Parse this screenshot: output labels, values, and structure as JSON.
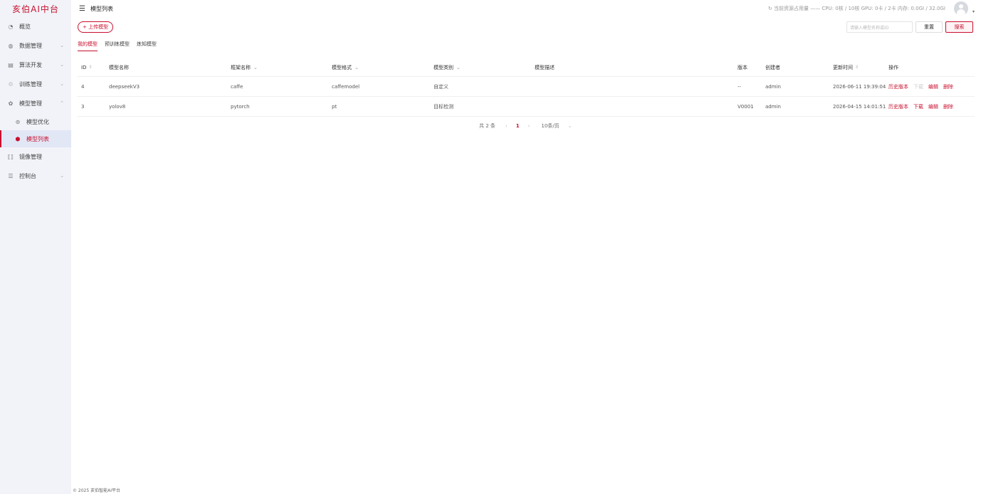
{
  "app": {
    "logo": "亥伯AI中台"
  },
  "sidebar": {
    "items": [
      {
        "label": "概览",
        "icon": "◔"
      },
      {
        "label": "数据管理",
        "icon": "◍",
        "arrow": "⌄"
      },
      {
        "label": "算法开发",
        "icon": "▤",
        "arrow": "⌄"
      },
      {
        "label": "训练管理",
        "icon": "♲",
        "arrow": "⌄"
      },
      {
        "label": "模型管理",
        "icon": "✿",
        "arrow": "⌃"
      },
      {
        "label": "模型优化",
        "icon": "⊚"
      },
      {
        "label": "模型列表",
        "icon": "⬢"
      },
      {
        "label": "镜像管理",
        "icon": "⟦⟧"
      },
      {
        "label": "控制台",
        "icon": "☰",
        "arrow": "⌄"
      }
    ]
  },
  "header": {
    "menu_icon": "☰",
    "title": "模型列表",
    "resource_text": "↻ 当前资源占用量 —— CPU: 0核 / 10核 GPU: 0卡 / 2卡 内存: 0.0GI / 32.0GI",
    "caret": "▾"
  },
  "toolbar": {
    "upload_label": "+ 上传模型",
    "search_placeholder": "请输入模型名称或ID",
    "reset_label": "重置",
    "search_label": "搜索"
  },
  "tabs": [
    {
      "label": "我的模型",
      "active": true
    },
    {
      "label": "预训练模型",
      "active": false
    },
    {
      "label": "炼知模型",
      "active": false
    }
  ],
  "table": {
    "columns": {
      "id": "ID",
      "name": "模型名称",
      "framework": "框架名称",
      "format": "模型格式",
      "category": "模型类别",
      "desc": "模型描述",
      "version": "版本",
      "creator": "创建者",
      "updated": "更新时间",
      "ops": "操作"
    },
    "sort_icon": "⇕",
    "filter_icon": "⌄",
    "rows": [
      {
        "id": "4",
        "name": "deepseekV3",
        "framework": "caffe",
        "format": "caffemodel",
        "category": "自定义",
        "desc": "",
        "version": "--",
        "creator": "admin",
        "updated": "2026-06-11 19:39:04",
        "ops": {
          "history": "历史版本",
          "download": "下载",
          "edit": "编辑",
          "delete": "删除"
        },
        "download_enabled": false
      },
      {
        "id": "3",
        "name": "yolov8",
        "framework": "pytorch",
        "format": "pt",
        "category": "目标检测",
        "desc": "",
        "version": "V0001",
        "creator": "admin",
        "updated": "2026-04-15 14:01:51",
        "ops": {
          "history": "历史版本",
          "download": "下载",
          "edit": "编辑",
          "delete": "删除"
        },
        "download_enabled": true
      }
    ]
  },
  "pagination": {
    "total": "共 2 条",
    "prev": "‹",
    "page": "1",
    "next": "›",
    "page_size": "10条/页",
    "dropdown": "⌄"
  },
  "footer": {
    "text": "© 2025 亥伯智能AI平台"
  },
  "colors": {
    "accent": "#c8102e",
    "sidebar_bg": "#f1f3f8",
    "active_bg": "#e2e7f6"
  }
}
